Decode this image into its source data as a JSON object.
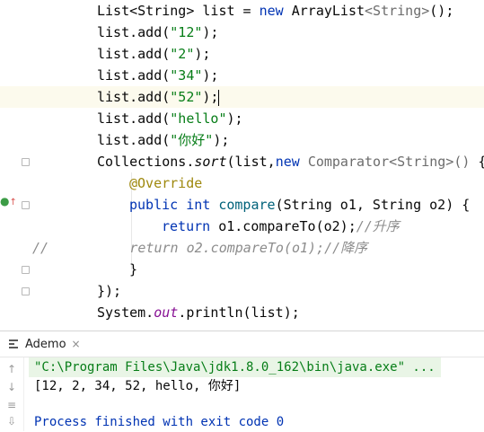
{
  "editor": {
    "lines": [
      {
        "indent": 0,
        "tokens": [
          {
            "cls": "plain",
            "text": "List<String> list = "
          },
          {
            "cls": "kw",
            "text": "new "
          },
          {
            "cls": "plain",
            "text": "ArrayList"
          },
          {
            "cls": "gen",
            "text": "<String>"
          },
          {
            "cls": "plain",
            "text": "();"
          }
        ]
      },
      {
        "indent": 0,
        "tokens": [
          {
            "cls": "plain",
            "text": "list.add("
          },
          {
            "cls": "str",
            "text": "\"12\""
          },
          {
            "cls": "plain",
            "text": ");"
          }
        ]
      },
      {
        "indent": 0,
        "tokens": [
          {
            "cls": "plain",
            "text": "list.add("
          },
          {
            "cls": "str",
            "text": "\"2\""
          },
          {
            "cls": "plain",
            "text": ");"
          }
        ]
      },
      {
        "indent": 0,
        "tokens": [
          {
            "cls": "plain",
            "text": "list.add("
          },
          {
            "cls": "str",
            "text": "\"34\""
          },
          {
            "cls": "plain",
            "text": ");"
          }
        ]
      },
      {
        "indent": 0,
        "current": true,
        "tokens": [
          {
            "cls": "plain",
            "text": "list.add("
          },
          {
            "cls": "str",
            "text": "\"52\""
          },
          {
            "cls": "plain",
            "text": ");"
          }
        ]
      },
      {
        "indent": 0,
        "tokens": [
          {
            "cls": "plain",
            "text": "list.add("
          },
          {
            "cls": "str",
            "text": "\"hello\""
          },
          {
            "cls": "plain",
            "text": ");"
          }
        ]
      },
      {
        "indent": 0,
        "tokens": [
          {
            "cls": "plain",
            "text": "list.add("
          },
          {
            "cls": "str",
            "text": "\"你好\""
          },
          {
            "cls": "plain",
            "text": ");"
          }
        ]
      },
      {
        "indent": 0,
        "fold": true,
        "tokens": [
          {
            "cls": "plain",
            "text": "Collections."
          },
          {
            "cls": "sortcall",
            "text": "sort"
          },
          {
            "cls": "plain",
            "text": "(list,"
          },
          {
            "cls": "kw",
            "text": "new "
          },
          {
            "cls": "gen",
            "text": "Comparator<String>() "
          },
          {
            "cls": "plain",
            "text": "{"
          }
        ]
      },
      {
        "indent": 1,
        "tokens": [
          {
            "cls": "ann",
            "text": "@Override"
          }
        ]
      },
      {
        "indent": 1,
        "fold": true,
        "tokens": [
          {
            "cls": "kw",
            "text": "public int "
          },
          {
            "cls": "method",
            "text": "compare"
          },
          {
            "cls": "plain",
            "text": "(String o1, String o2) {"
          }
        ]
      },
      {
        "indent": 2,
        "tokens": [
          {
            "cls": "kw",
            "text": "return "
          },
          {
            "cls": "plain",
            "text": "o1.compareTo(o2);"
          },
          {
            "cls": "cmt",
            "text": "//升序"
          }
        ]
      },
      {
        "indent": 0,
        "commented": true,
        "tokens": [
          {
            "cls": "cmt",
            "text": "//          return o2.compareTo(o1);//降序"
          }
        ]
      },
      {
        "indent": 1,
        "fold": true,
        "tokens": [
          {
            "cls": "plain",
            "text": "}"
          }
        ]
      },
      {
        "indent": 0,
        "fold": true,
        "tokens": [
          {
            "cls": "plain",
            "text": "});"
          }
        ]
      },
      {
        "indent": 0,
        "tokens": [
          {
            "cls": "plain",
            "text": "System."
          },
          {
            "cls": "field",
            "text": "out"
          },
          {
            "cls": "plain",
            "text": ".println(list);"
          }
        ]
      }
    ]
  },
  "run_panel": {
    "tab_label": "Ademo",
    "close_glyph": "×",
    "toolbar_glyphs": [
      "↑",
      "↓",
      "≡",
      "⇩"
    ],
    "command": "\"C:\\Program Files\\Java\\jdk1.8.0_162\\bin\\java.exe\" ...",
    "output": "[12, 2, 34, 52, hello, 你好]",
    "exit_message": "Process finished with exit code 0"
  },
  "colors": {
    "keyword": "#0033b3",
    "string": "#067d17",
    "comment": "#8c8c8c",
    "annotation": "#9e880d",
    "method": "#00627a",
    "field": "#871094",
    "current_line": "#fcfaed"
  }
}
